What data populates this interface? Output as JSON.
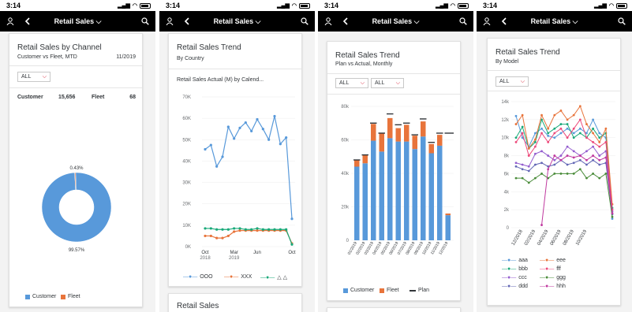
{
  "status_time": "3:14",
  "nav_title": "Retail Sales",
  "colors": {
    "customer": "#5899da",
    "fleet": "#e8743b",
    "green": "#19a979",
    "navbar": "#000000"
  },
  "screen1": {
    "title": "Retail Sales by Channel",
    "subtitle": "Customer vs Fleet, MTD",
    "date": "11/2019",
    "filter": "ALL",
    "customer_label": "Customer",
    "customer_value": "15,656",
    "fleet_label": "Fleet",
    "fleet_value": "68",
    "legend": [
      "Customer",
      "Fleet"
    ],
    "chart_data": {
      "type": "pie",
      "title": "",
      "slices": [
        {
          "name": "Customer",
          "value": 99.57,
          "label": "99.57%"
        },
        {
          "name": "Fleet",
          "value": 0.43,
          "label": "0.43%"
        }
      ]
    }
  },
  "screen2": {
    "title": "Retail Sales Trend",
    "subtitle": "By Country",
    "chart_title": "Retail Sales Actual (M) by Calend...",
    "yticks": [
      "70K",
      "60K",
      "50K",
      "40K",
      "30K",
      "20K",
      "10K",
      "0K"
    ],
    "xticks": [
      "Oct",
      "Mar",
      "Jun",
      "Oct"
    ],
    "xyears": [
      "2018",
      "2019"
    ],
    "legend": [
      "OOO",
      "XXX",
      "△ △"
    ],
    "next_card_title": "Retail Sales",
    "chart_data": {
      "type": "line",
      "ylim": [
        0,
        70000
      ],
      "series": [
        {
          "name": "OOO",
          "values": [
            45500,
            47500,
            37500,
            42000,
            56000,
            50500,
            55500,
            58000,
            54000,
            59500,
            55000,
            50000,
            61000,
            48000,
            51000,
            13000
          ]
        },
        {
          "name": "XXX",
          "values": [
            5000,
            5000,
            4000,
            4000,
            5000,
            7000,
            7500,
            7500,
            7500,
            7500,
            7500,
            7500,
            7500,
            7500,
            7500,
            1500
          ]
        },
        {
          "name": "△ △",
          "values": [
            8500,
            8500,
            8000,
            8000,
            8000,
            8500,
            8500,
            8000,
            8000,
            8500,
            8000,
            8000,
            8000,
            8000,
            8000,
            1000
          ]
        }
      ]
    }
  },
  "screen3": {
    "title": "Retail Sales Trend",
    "subtitle": "Plan vs Actual, Monthly",
    "filter1": "ALL",
    "filter2": "ALL",
    "yticks": [
      "80k",
      "60k",
      "40k",
      "20k",
      "0"
    ],
    "legend": [
      "Customer",
      "Fleet",
      "Plan"
    ],
    "chart_data": {
      "type": "bar",
      "ylim": [
        0,
        80000
      ],
      "categories": [
        "01/2019",
        "02/2019",
        "03/2019",
        "04/2019",
        "05/2019",
        "06/2019",
        "07/2019",
        "08/2019",
        "09/2019",
        "10/2019",
        "11/2019",
        "12/2019"
      ],
      "series": [
        {
          "name": "Customer",
          "values": [
            44000,
            46000,
            59500,
            53000,
            61000,
            59000,
            59000,
            54500,
            62000,
            52000,
            56500,
            15000
          ]
        },
        {
          "name": "Fleet",
          "values": [
            4000,
            5000,
            10000,
            11000,
            12000,
            8000,
            10000,
            8000,
            9000,
            5500,
            6500,
            1000
          ]
        },
        {
          "name": "Plan",
          "values": [
            48000,
            51000,
            70000,
            64000,
            75500,
            69000,
            70000,
            63000,
            72500,
            58500,
            64000,
            64000
          ]
        }
      ]
    }
  },
  "screen4": {
    "title": "Retail Sales Trend",
    "subtitle": "By Model",
    "filter": "ALL",
    "yticks": [
      "14k",
      "12k",
      "10k",
      "8k",
      "6k",
      "4k",
      "2k",
      "0"
    ],
    "xticks": [
      "12/2018",
      "02/2019",
      "04/2019",
      "06/2019",
      "08/2019",
      "10/2019"
    ],
    "legend": [
      "aaa",
      "eee",
      "bbb",
      "fff",
      "ccc",
      "ggg",
      "ddd",
      "hhh"
    ],
    "chart_data": {
      "type": "line",
      "ylim": [
        0,
        14000
      ],
      "series": [
        {
          "name": "aaa",
          "color": "#5899da",
          "values": [
            12400,
            10000,
            9000,
            10500,
            11000,
            10200,
            10000,
            10500,
            11000,
            10500,
            11000,
            10500,
            12000,
            10500,
            10000,
            1000
          ]
        },
        {
          "name": "bbb",
          "color": "#19a979",
          "values": [
            10000,
            11200,
            8800,
            9500,
            12000,
            10500,
            11000,
            11500,
            11500,
            10000,
            10500,
            10000,
            11000,
            10000,
            10500,
            2200
          ]
        },
        {
          "name": "ccc",
          "color": "#945ecf",
          "values": [
            7200,
            7000,
            6800,
            8200,
            8500,
            8000,
            7500,
            8000,
            9000,
            8500,
            8000,
            8500,
            9000,
            8000,
            8500,
            1800
          ]
        },
        {
          "name": "ddd",
          "color": "#6367b5",
          "values": [
            6800,
            6500,
            6300,
            7000,
            7200,
            6800,
            7000,
            7500,
            7000,
            7200,
            7500,
            7000,
            7500,
            7000,
            7200,
            1500
          ]
        },
        {
          "name": "eee",
          "color": "#e8743b",
          "values": [
            11500,
            12500,
            8800,
            9800,
            12500,
            11000,
            12500,
            13000,
            12000,
            12500,
            13500,
            11500,
            10500,
            9500,
            11000,
            2600
          ]
        },
        {
          "name": "fff",
          "color": "#ed4a7b",
          "values": [
            9500,
            10500,
            8000,
            9000,
            10500,
            9500,
            10500,
            11000,
            10000,
            11000,
            12000,
            10000,
            9500,
            9000,
            9500,
            2000
          ]
        },
        {
          "name": "ggg",
          "color": "#4a8c3a",
          "values": [
            5500,
            5500,
            5000,
            5500,
            6000,
            5500,
            6000,
            6000,
            6000,
            6000,
            6500,
            5500,
            6000,
            5500,
            6000,
            1200
          ]
        },
        {
          "name": "hhh",
          "color": "#c0399f",
          "values": [
            null,
            null,
            null,
            null,
            300,
            6500,
            8000,
            7500,
            8000,
            7800,
            8000,
            7500,
            8000,
            7500,
            7800,
            1600
          ]
        }
      ]
    }
  }
}
